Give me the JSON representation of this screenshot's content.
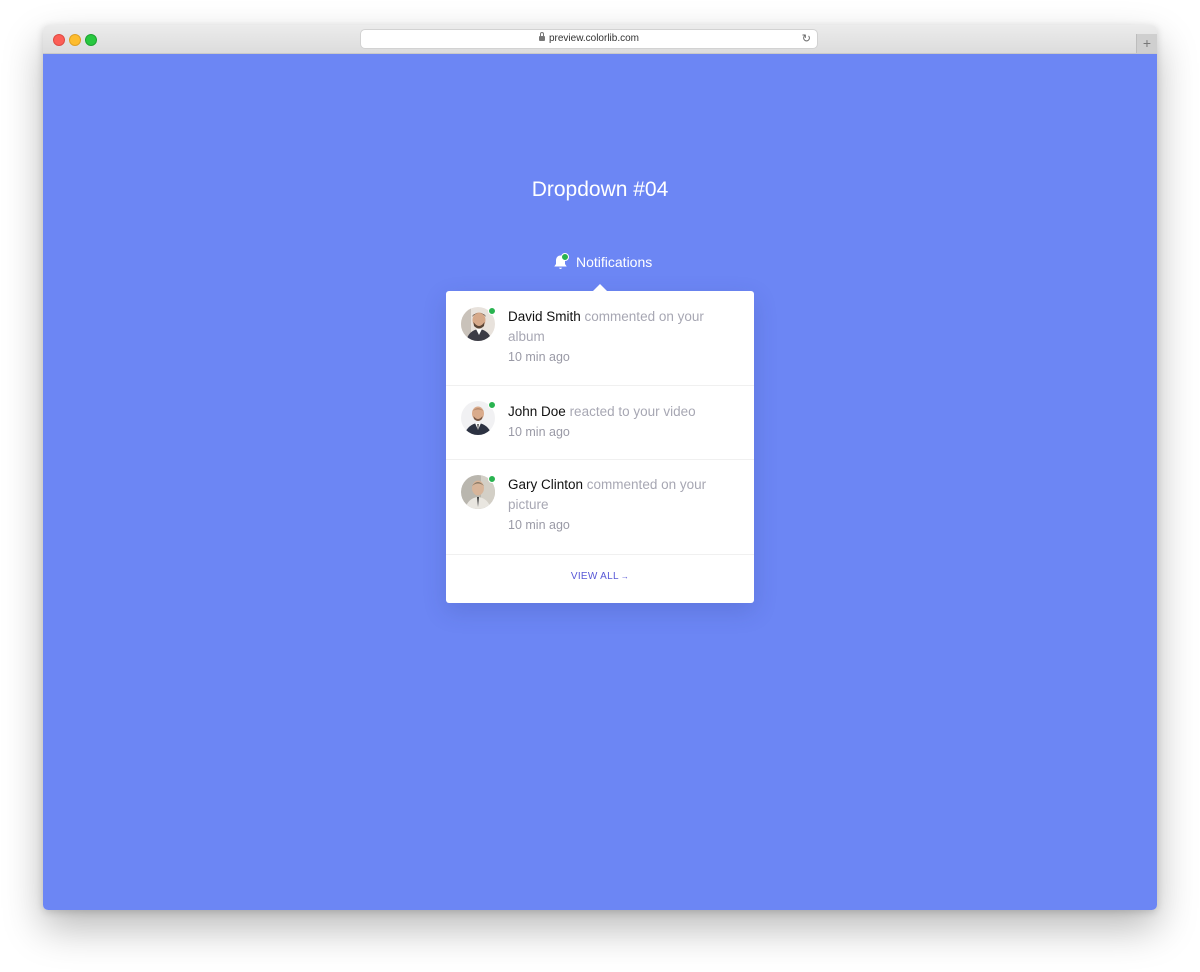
{
  "browser": {
    "url": "preview.colorlib.com",
    "newtab_label": "+"
  },
  "page": {
    "title": "Dropdown #04",
    "background_color": "#6c86f4"
  },
  "notifications": {
    "toggle_label": "Notifications",
    "items": [
      {
        "name": "David Smith",
        "action": "commented on your album",
        "time": "10 min ago",
        "online": true
      },
      {
        "name": "John Doe",
        "action": "reacted to your video",
        "time": "10 min ago",
        "online": true
      },
      {
        "name": "Gary Clinton",
        "action": "commented on your picture",
        "time": "10 min ago",
        "online": true
      }
    ],
    "view_all_label": "VIEW ALL",
    "view_all_arrow": "→"
  }
}
